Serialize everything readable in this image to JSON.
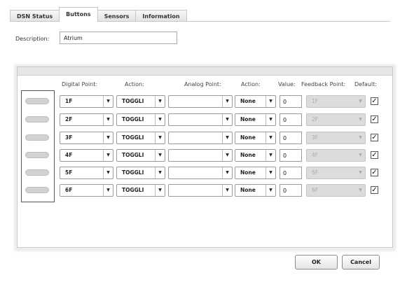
{
  "tabs": [
    {
      "label": "DSN Status"
    },
    {
      "label": "Buttons"
    },
    {
      "label": "Sensors"
    },
    {
      "label": "Information"
    }
  ],
  "active_tab": "Buttons",
  "description": {
    "label": "Description:",
    "value": "Atrium"
  },
  "columns": {
    "digital_point": "Digital Point:",
    "action1": "Action:",
    "analog_point": "Analog Point:",
    "action2": "Action:",
    "value": "Value:",
    "feedback_point": "Feedback Point:",
    "default": "Default:"
  },
  "rows": [
    {
      "digital_point": "1F",
      "action1": "TOGGLI",
      "analog_point": "",
      "action2": "None",
      "value": "0",
      "feedback_point": "1F",
      "default_checked": "✓"
    },
    {
      "digital_point": "2F",
      "action1": "TOGGLI",
      "analog_point": "",
      "action2": "None",
      "value": "0",
      "feedback_point": "2F",
      "default_checked": "✓"
    },
    {
      "digital_point": "3F",
      "action1": "TOGGLI",
      "analog_point": "",
      "action2": "None",
      "value": "0",
      "feedback_point": "3F",
      "default_checked": "✓"
    },
    {
      "digital_point": "4F",
      "action1": "TOGGLI",
      "analog_point": "",
      "action2": "None",
      "value": "0",
      "feedback_point": "4F",
      "default_checked": "✓"
    },
    {
      "digital_point": "5F",
      "action1": "TOGGLI",
      "analog_point": "",
      "action2": "None",
      "value": "0",
      "feedback_point": "5F",
      "default_checked": "✓"
    },
    {
      "digital_point": "6F",
      "action1": "TOGGLI",
      "analog_point": "",
      "action2": "None",
      "value": "0",
      "feedback_point": "6F",
      "default_checked": "✓"
    }
  ],
  "icons": {
    "dropdown": "chevron-down-icon",
    "checkbox": "checkmark-icon"
  },
  "buttons": {
    "ok": "OK",
    "cancel": "Cancel"
  }
}
